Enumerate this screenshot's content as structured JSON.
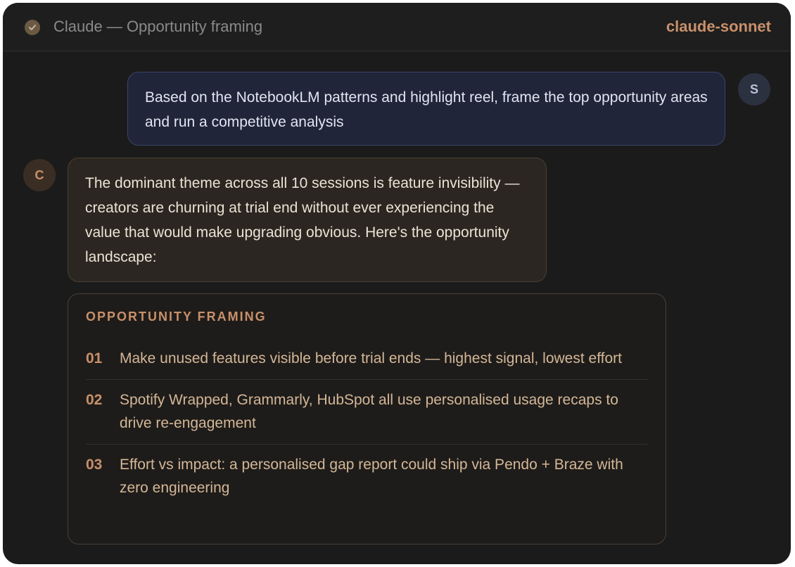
{
  "window": {
    "title": "Claude — Opportunity framing",
    "model": "claude-sonnet",
    "status_icon": "check-circle-icon"
  },
  "messages": {
    "user": {
      "avatar_initial": "S",
      "text": "Based on the NotebookLM patterns and highlight reel, frame the top opportunity areas and run a competitive analysis"
    },
    "assistant": {
      "avatar_initial": "C",
      "text": "The dominant theme across all 10 sessions is feature invisibility — creators are churning at trial end without ever experiencing the value that would make upgrading obvious. Here's the opportunity landscape:"
    }
  },
  "opportunity_card": {
    "heading": "OPPORTUNITY FRAMING",
    "items": [
      {
        "number": "01",
        "text": "Make unused features visible before trial ends — highest signal, lowest effort"
      },
      {
        "number": "02",
        "text": "Spotify Wrapped, Grammarly, HubSpot all use personalised usage recaps to drive re-engagement"
      },
      {
        "number": "03",
        "text": "Effort vs impact: a personalised gap report could ship via Pendo + Braze with zero engineering"
      }
    ]
  },
  "colors": {
    "accent": "#c8906a",
    "window_bg": "#1b1b1b",
    "user_bubble_bg": "#20253a",
    "assistant_bubble_bg": "#2b2621"
  }
}
